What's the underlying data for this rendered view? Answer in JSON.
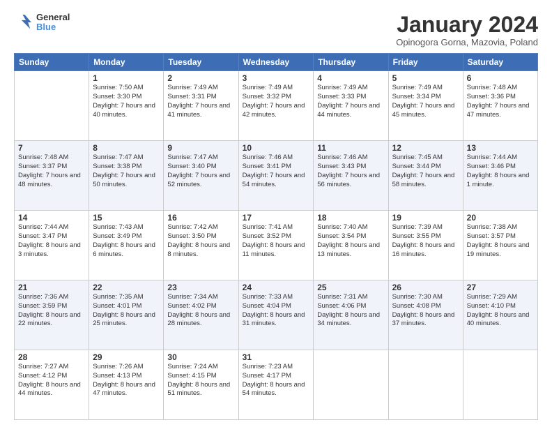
{
  "header": {
    "logo": {
      "line1": "General",
      "line2": "Blue"
    },
    "title": "January 2024",
    "subtitle": "Opinogora Gorna, Mazovia, Poland"
  },
  "weekdays": [
    "Sunday",
    "Monday",
    "Tuesday",
    "Wednesday",
    "Thursday",
    "Friday",
    "Saturday"
  ],
  "weeks": [
    [
      {
        "day": "",
        "info": ""
      },
      {
        "day": "1",
        "info": "Sunrise: 7:50 AM\nSunset: 3:30 PM\nDaylight: 7 hours\nand 40 minutes."
      },
      {
        "day": "2",
        "info": "Sunrise: 7:49 AM\nSunset: 3:31 PM\nDaylight: 7 hours\nand 41 minutes."
      },
      {
        "day": "3",
        "info": "Sunrise: 7:49 AM\nSunset: 3:32 PM\nDaylight: 7 hours\nand 42 minutes."
      },
      {
        "day": "4",
        "info": "Sunrise: 7:49 AM\nSunset: 3:33 PM\nDaylight: 7 hours\nand 44 minutes."
      },
      {
        "day": "5",
        "info": "Sunrise: 7:49 AM\nSunset: 3:34 PM\nDaylight: 7 hours\nand 45 minutes."
      },
      {
        "day": "6",
        "info": "Sunrise: 7:48 AM\nSunset: 3:36 PM\nDaylight: 7 hours\nand 47 minutes."
      }
    ],
    [
      {
        "day": "7",
        "info": "Sunrise: 7:48 AM\nSunset: 3:37 PM\nDaylight: 7 hours\nand 48 minutes."
      },
      {
        "day": "8",
        "info": "Sunrise: 7:47 AM\nSunset: 3:38 PM\nDaylight: 7 hours\nand 50 minutes."
      },
      {
        "day": "9",
        "info": "Sunrise: 7:47 AM\nSunset: 3:40 PM\nDaylight: 7 hours\nand 52 minutes."
      },
      {
        "day": "10",
        "info": "Sunrise: 7:46 AM\nSunset: 3:41 PM\nDaylight: 7 hours\nand 54 minutes."
      },
      {
        "day": "11",
        "info": "Sunrise: 7:46 AM\nSunset: 3:43 PM\nDaylight: 7 hours\nand 56 minutes."
      },
      {
        "day": "12",
        "info": "Sunrise: 7:45 AM\nSunset: 3:44 PM\nDaylight: 7 hours\nand 58 minutes."
      },
      {
        "day": "13",
        "info": "Sunrise: 7:44 AM\nSunset: 3:46 PM\nDaylight: 8 hours\nand 1 minute."
      }
    ],
    [
      {
        "day": "14",
        "info": "Sunrise: 7:44 AM\nSunset: 3:47 PM\nDaylight: 8 hours\nand 3 minutes."
      },
      {
        "day": "15",
        "info": "Sunrise: 7:43 AM\nSunset: 3:49 PM\nDaylight: 8 hours\nand 6 minutes."
      },
      {
        "day": "16",
        "info": "Sunrise: 7:42 AM\nSunset: 3:50 PM\nDaylight: 8 hours\nand 8 minutes."
      },
      {
        "day": "17",
        "info": "Sunrise: 7:41 AM\nSunset: 3:52 PM\nDaylight: 8 hours\nand 11 minutes."
      },
      {
        "day": "18",
        "info": "Sunrise: 7:40 AM\nSunset: 3:54 PM\nDaylight: 8 hours\nand 13 minutes."
      },
      {
        "day": "19",
        "info": "Sunrise: 7:39 AM\nSunset: 3:55 PM\nDaylight: 8 hours\nand 16 minutes."
      },
      {
        "day": "20",
        "info": "Sunrise: 7:38 AM\nSunset: 3:57 PM\nDaylight: 8 hours\nand 19 minutes."
      }
    ],
    [
      {
        "day": "21",
        "info": "Sunrise: 7:36 AM\nSunset: 3:59 PM\nDaylight: 8 hours\nand 22 minutes."
      },
      {
        "day": "22",
        "info": "Sunrise: 7:35 AM\nSunset: 4:01 PM\nDaylight: 8 hours\nand 25 minutes."
      },
      {
        "day": "23",
        "info": "Sunrise: 7:34 AM\nSunset: 4:02 PM\nDaylight: 8 hours\nand 28 minutes."
      },
      {
        "day": "24",
        "info": "Sunrise: 7:33 AM\nSunset: 4:04 PM\nDaylight: 8 hours\nand 31 minutes."
      },
      {
        "day": "25",
        "info": "Sunrise: 7:31 AM\nSunset: 4:06 PM\nDaylight: 8 hours\nand 34 minutes."
      },
      {
        "day": "26",
        "info": "Sunrise: 7:30 AM\nSunset: 4:08 PM\nDaylight: 8 hours\nand 37 minutes."
      },
      {
        "day": "27",
        "info": "Sunrise: 7:29 AM\nSunset: 4:10 PM\nDaylight: 8 hours\nand 40 minutes."
      }
    ],
    [
      {
        "day": "28",
        "info": "Sunrise: 7:27 AM\nSunset: 4:12 PM\nDaylight: 8 hours\nand 44 minutes."
      },
      {
        "day": "29",
        "info": "Sunrise: 7:26 AM\nSunset: 4:13 PM\nDaylight: 8 hours\nand 47 minutes."
      },
      {
        "day": "30",
        "info": "Sunrise: 7:24 AM\nSunset: 4:15 PM\nDaylight: 8 hours\nand 51 minutes."
      },
      {
        "day": "31",
        "info": "Sunrise: 7:23 AM\nSunset: 4:17 PM\nDaylight: 8 hours\nand 54 minutes."
      },
      {
        "day": "",
        "info": ""
      },
      {
        "day": "",
        "info": ""
      },
      {
        "day": "",
        "info": ""
      }
    ]
  ]
}
